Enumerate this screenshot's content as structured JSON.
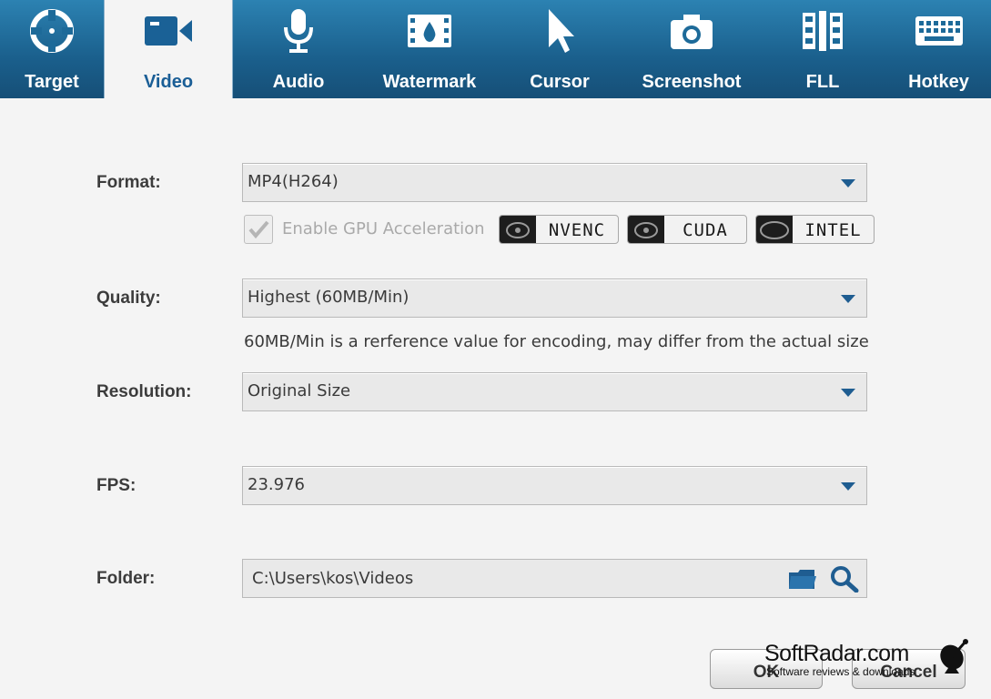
{
  "tabs": [
    {
      "label": "Target",
      "icon": "target-icon",
      "active": false
    },
    {
      "label": "Video",
      "icon": "video-camera-icon",
      "active": true
    },
    {
      "label": "Audio",
      "icon": "microphone-icon",
      "active": false
    },
    {
      "label": "Watermark",
      "icon": "watermark-icon",
      "active": false
    },
    {
      "label": "Cursor",
      "icon": "cursor-icon",
      "active": false
    },
    {
      "label": "Screenshot",
      "icon": "camera-icon",
      "active": false
    },
    {
      "label": "FLL",
      "icon": "film-icon",
      "active": false
    },
    {
      "label": "Hotkey",
      "icon": "keyboard-icon",
      "active": false
    }
  ],
  "form": {
    "format": {
      "label": "Format:",
      "value": "MP4(H264)"
    },
    "gpu": {
      "label": "Enable GPU Acceleration",
      "checked": true,
      "disabled": true,
      "badges": [
        "NVENC",
        "CUDA",
        "INTEL"
      ]
    },
    "quality": {
      "label": "Quality:",
      "value": "Highest (60MB/Min)",
      "hint": "60MB/Min is a rerference value for encoding, may differ from the actual size"
    },
    "resolution": {
      "label": "Resolution:",
      "value": "Original Size"
    },
    "fps": {
      "label": "FPS:",
      "value": "23.976"
    },
    "folder": {
      "label": "Folder:",
      "value": "C:\\Users\\kos\\Videos"
    }
  },
  "buttons": {
    "ok": "OK",
    "cancel": "Cancel"
  },
  "watermark": {
    "title": "SoftRadar.com",
    "subtitle": "Software reviews & downloads"
  },
  "colors": {
    "toolbar": "#1a5f8c",
    "accent": "#1f5d91"
  }
}
